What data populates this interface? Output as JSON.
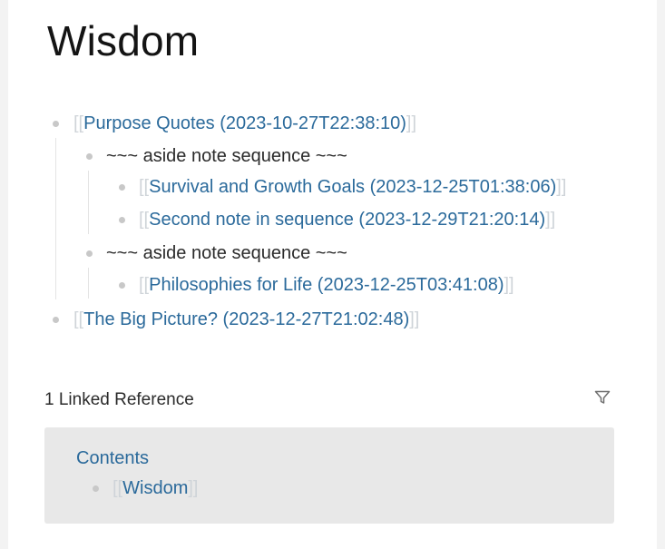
{
  "page": {
    "title": "Wisdom"
  },
  "outline": {
    "item1": {
      "link": "Purpose Quotes (2023-10-27T22:38:10)"
    },
    "aside1": {
      "text": "~~~ aside note sequence ~~~"
    },
    "item1a": {
      "link": "Survival and Growth Goals (2023-12-25T01:38:06)"
    },
    "item1b": {
      "link": "Second note in sequence (2023-12-29T21:20:14)"
    },
    "aside2": {
      "text": "~~~ aside note sequence ~~~"
    },
    "item2a": {
      "link": "Philosophies for Life (2023-12-25T03:41:08)"
    },
    "item2": {
      "link": "The Big Picture? (2023-12-27T21:02:48)"
    }
  },
  "brackets": {
    "open": "[[",
    "close": "]]"
  },
  "linked_references": {
    "header": "1 Linked Reference",
    "filter_icon": "filter-icon",
    "page_title": "Contents",
    "block_link": "Wisdom"
  },
  "colors": {
    "link": "#2b6a9b",
    "bracket": "#cfd4d9",
    "bullet": "#c8c8c8",
    "card": "#e8e8e8"
  }
}
